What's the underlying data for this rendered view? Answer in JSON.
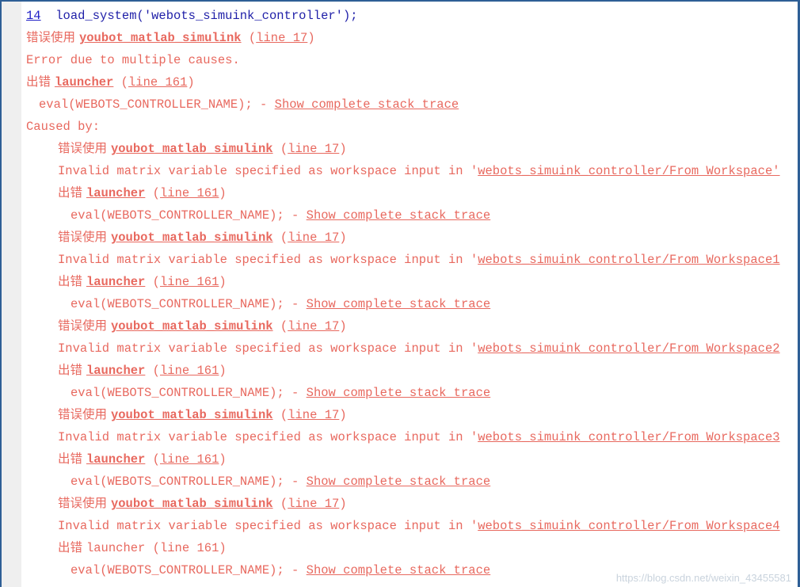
{
  "window": {
    "kind": "matlab-command-window",
    "accent_border_color": "#2e5f96",
    "gutter_color": "#efefef",
    "error_text_color": "#e8695f",
    "command_text_color": "#1f1fa8",
    "link_color": "#2121c7"
  },
  "watermark": {
    "text": "https://blog.csdn.net/weixin_43455581"
  },
  "strings": {
    "line_number_14": "14",
    "cmd_load_system": "  load_system('webots_simuink_controller');",
    "cuowu_shiyong": "错误使用 ",
    "chucuo": "出错 ",
    "youbot_link": "youbot_matlab_simulink",
    "launcher_link": "launcher",
    "line_17": "(line 17)",
    "line_161": "(line 161)",
    "line_17_paren_open": "(",
    "line_17_text": "line 17",
    "line_161_text": "line 161",
    "paren_close": ")",
    "error_multiple_causes": "Error due to multiple causes.",
    "eval_prefix": "eval(WEBOTS_CONTROLLER_NAME); - ",
    "show_stack_trace": "Show complete stack trace",
    "caused_by": "Caused by:",
    "invalid_matrix_prefix": "Invalid matrix variable specified as workspace input in '",
    "workspace_path_0": "webots_simuink_controller/From Workspace'",
    "workspace_path_1": "webots_simuink_controller/From Workspace1",
    "workspace_path_2": "webots_simuink_controller/From Workspace2",
    "workspace_path_3": "webots_simuink_controller/From Workspace3",
    "workspace_path_4": "webots_simuink_controller/From Workspace4",
    "chucuo_launcher_plain": "出错 launcher (line 161)"
  },
  "lines": [
    {
      "id": "l01",
      "type": "command",
      "indent": "indent1"
    },
    {
      "id": "l02",
      "type": "cuowu",
      "indent": "indent1"
    },
    {
      "id": "l03",
      "type": "plain-error",
      "indent": "indent1",
      "text_key": "error_multiple_causes"
    },
    {
      "id": "l04",
      "type": "chucuo",
      "indent": "indent1"
    },
    {
      "id": "l05",
      "type": "eval",
      "indent": "indent-eval"
    },
    {
      "id": "l06",
      "type": "plain-error",
      "indent": "indent1",
      "text_key": "caused_by"
    },
    {
      "id": "l07",
      "type": "cuowu",
      "indent": "indent2"
    },
    {
      "id": "l08",
      "type": "invalid-matrix",
      "indent": "indent2",
      "path_key": "workspace_path_0"
    },
    {
      "id": "l09",
      "type": "chucuo",
      "indent": "indent2"
    },
    {
      "id": "l10",
      "type": "eval",
      "indent": "indent-eval2"
    },
    {
      "id": "l11",
      "type": "cuowu",
      "indent": "indent2"
    },
    {
      "id": "l12",
      "type": "invalid-matrix",
      "indent": "indent2",
      "path_key": "workspace_path_1"
    },
    {
      "id": "l13",
      "type": "chucuo",
      "indent": "indent2"
    },
    {
      "id": "l14",
      "type": "eval",
      "indent": "indent-eval2"
    },
    {
      "id": "l15",
      "type": "cuowu",
      "indent": "indent2"
    },
    {
      "id": "l16",
      "type": "invalid-matrix",
      "indent": "indent2",
      "path_key": "workspace_path_2"
    },
    {
      "id": "l17",
      "type": "chucuo",
      "indent": "indent2"
    },
    {
      "id": "l18",
      "type": "eval",
      "indent": "indent-eval2"
    },
    {
      "id": "l19",
      "type": "cuowu",
      "indent": "indent2"
    },
    {
      "id": "l20",
      "type": "invalid-matrix",
      "indent": "indent2",
      "path_key": "workspace_path_3"
    },
    {
      "id": "l21",
      "type": "chucuo",
      "indent": "indent2"
    },
    {
      "id": "l22",
      "type": "eval",
      "indent": "indent-eval2"
    },
    {
      "id": "l23",
      "type": "cuowu",
      "indent": "indent2"
    },
    {
      "id": "l24",
      "type": "invalid-matrix",
      "indent": "indent2",
      "path_key": "workspace_path_4"
    },
    {
      "id": "l25",
      "type": "chucuo-plain",
      "indent": "indent2"
    },
    {
      "id": "l26",
      "type": "eval",
      "indent": "indent-eval2"
    }
  ]
}
